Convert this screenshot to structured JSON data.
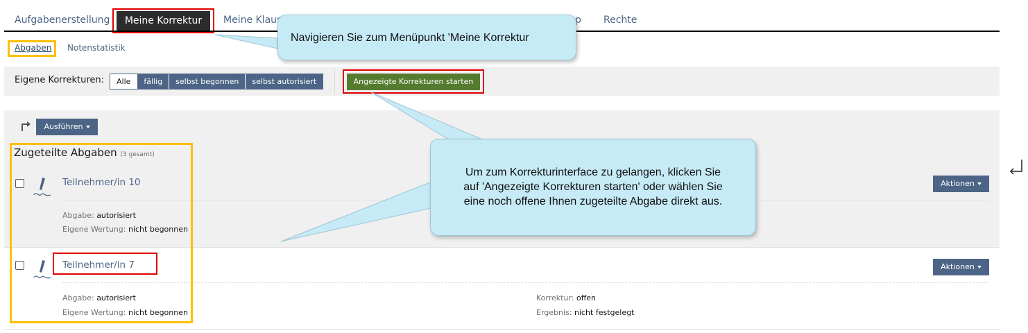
{
  "tabs": {
    "items": [
      "Aufgabenerstellung",
      "Meine Korrektur",
      "Meine Klaus",
      "p",
      "Rechte"
    ],
    "active": "Meine Korrektur"
  },
  "subtabs": {
    "items": [
      "Abgaben",
      "Notenstatistik"
    ],
    "active": "Abgaben"
  },
  "filter": {
    "label": "Eigene Korrekturen:",
    "options": [
      "Alle",
      "fällig",
      "selbst begonnen",
      "selbst autorisiert"
    ],
    "selected": "Alle",
    "start_button": "Angezeigte Korrekturen starten"
  },
  "actions": {
    "execute_button": "Ausführen"
  },
  "list": {
    "title": "Zugeteilte Abgaben",
    "count": "(3 gesamt)",
    "rows": [
      {
        "name": "Teilnehmer/in 10",
        "submission_label": "Abgabe:",
        "submission_value": "autorisiert",
        "own_rating_label": "Eigene Wertung:",
        "own_rating_value": "nicht begonnen",
        "correction_label": "",
        "correction_value": "",
        "result_label": "",
        "result_value": "",
        "actions_button": "Aktionen"
      },
      {
        "name": "Teilnehmer/in 7",
        "submission_label": "Abgabe:",
        "submission_value": "autorisiert",
        "own_rating_label": "Eigene Wertung:",
        "own_rating_value": "nicht begonnen",
        "correction_label": "Korrektur:",
        "correction_value": "offen",
        "result_label": "Ergebnis:",
        "result_value": "nicht festgelegt",
        "actions_button": "Aktionen"
      }
    ]
  },
  "callouts": {
    "menu_hint": "Navigieren Sie zum Menüpunkt 'Meine Korrektur",
    "start_hint_lines": [
      "Um zum Korrekturinterface zu gelangen, klicken Sie",
      "auf 'Angezeigte Korrekturen starten' oder wählen Sie",
      "eine noch offene Ihnen zugeteilte Abgabe direkt aus."
    ]
  },
  "colors": {
    "primary": "#4c6586",
    "success": "#557b2e",
    "highlight_red": "#e00000",
    "highlight_yellow": "#ffbf00",
    "callout": "#c6eaf6"
  },
  "icons": {
    "execute": "arrow-return-icon",
    "row": "pen-signature-icon",
    "outside": "return-arrow-icon"
  }
}
